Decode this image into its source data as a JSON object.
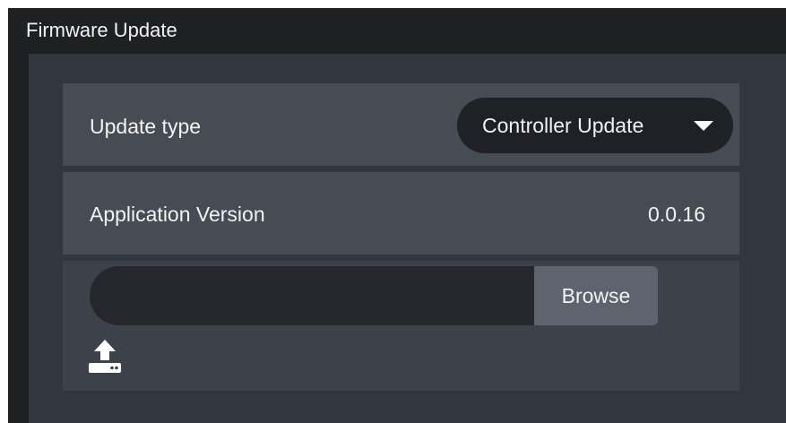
{
  "window": {
    "title": "Firmware Update"
  },
  "update_type": {
    "label": "Update type",
    "selected": "Controller Update"
  },
  "application_version": {
    "label": "Application Version",
    "value": "0.0.16"
  },
  "file_upload": {
    "value": "",
    "browse_label": "Browse",
    "upload_icon": "upload-icon"
  },
  "colors": {
    "window_bg": "#1f2022",
    "panel_bg": "#32363e",
    "row_bg": "#474b53",
    "select_bg": "#1f2126",
    "browse_bg": "#5d646d",
    "text": "#f2f2f2"
  }
}
